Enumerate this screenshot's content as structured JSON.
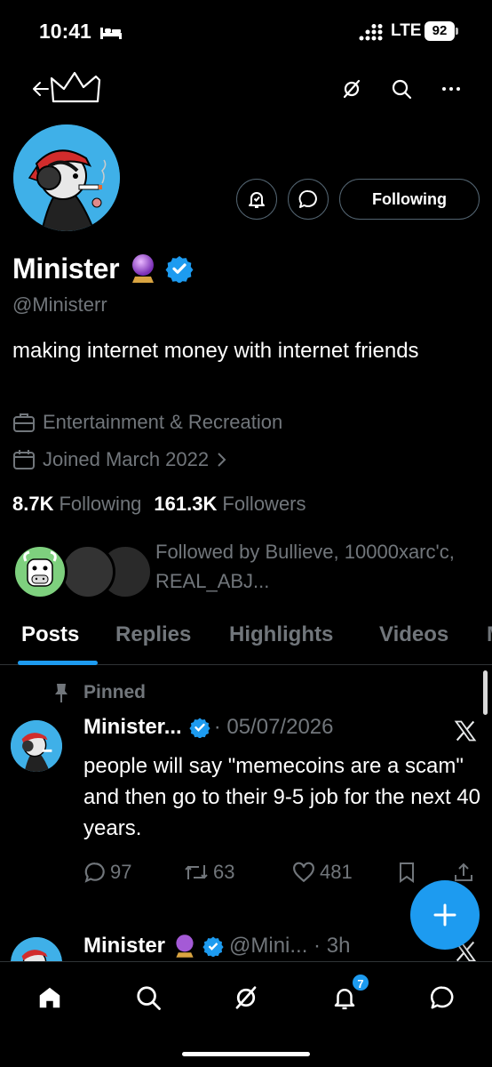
{
  "status_bar": {
    "time": "10:41",
    "network": "LTE",
    "battery": "92",
    "icons": [
      "bed-icon",
      "signal-icon"
    ]
  },
  "top_nav": {
    "icons": [
      "back-arrow-icon",
      "crown-icon",
      "grok-icon",
      "search-icon",
      "more-icon"
    ]
  },
  "profile": {
    "follow_button": "Following",
    "display_name": "Minister",
    "handle": "@Ministerr",
    "bio": "making internet money with internet friends",
    "category": "Entertainment & Recreation",
    "joined": "Joined March 2022",
    "following_count": "8.7K",
    "following_label": "Following",
    "followers_count": "161.3K",
    "followers_label": "Followers",
    "followed_by": "Followed by Bullieve, 10000xarc'c, REAL_ABJ...",
    "accent": "#1d9bf0"
  },
  "tabs": [
    "Posts",
    "Replies",
    "Highlights",
    "Videos"
  ],
  "pinned_tweet": {
    "pinned_label": "Pinned",
    "name": "Minister...",
    "meta": "· 05/07/2026",
    "text": "people will say \"memecoins are a scam\" and then go to their 9-5 job for the next 40 years.",
    "replies": "97",
    "reposts": "63",
    "likes": "481"
  },
  "second_tweet": {
    "name": "Minister",
    "meta": "@Mini... · 3h"
  },
  "bottom_nav": {
    "icons": [
      "home-icon",
      "search-icon",
      "grok-icon",
      "notifications-icon",
      "messages-icon"
    ],
    "notification_badge": "7"
  },
  "fab_icon": "plus-icon"
}
